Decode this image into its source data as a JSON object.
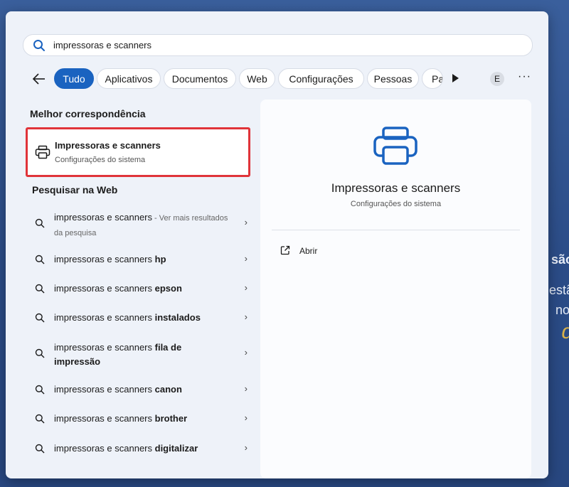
{
  "search": {
    "value": "impressoras e scanners"
  },
  "filters": {
    "tabs": [
      {
        "label": "Tudo",
        "active": true
      },
      {
        "label": "Aplicativos"
      },
      {
        "label": "Documentos"
      },
      {
        "label": "Web"
      },
      {
        "label": "Configurações"
      },
      {
        "label": "Pessoas"
      },
      {
        "label": "Pas"
      }
    ],
    "avatar_initial": "E",
    "more_label": "···"
  },
  "best_match": {
    "section_title": "Melhor correspondência",
    "title": "Impressoras e scanners",
    "subtitle": "Configurações do sistema",
    "icon": "printer-icon"
  },
  "web_search": {
    "section_title": "Pesquisar na Web",
    "items": [
      {
        "plain": "impressoras e scanners",
        "bold": "",
        "hint": " - Ver mais resultados da pesquisa"
      },
      {
        "plain": "impressoras e scanners ",
        "bold": "hp"
      },
      {
        "plain": "impressoras e scanners ",
        "bold": "epson"
      },
      {
        "plain": "impressoras e scanners ",
        "bold": "instalados"
      },
      {
        "plain": "impressoras e scanners ",
        "bold": "fila de impressão"
      },
      {
        "plain": "impressoras e scanners ",
        "bold": "canon"
      },
      {
        "plain": "impressoras e scanners ",
        "bold": "brother"
      },
      {
        "plain": "impressoras e scanners ",
        "bold": "digitalizar"
      }
    ]
  },
  "detail": {
    "title": "Impressoras e scanners",
    "subtitle": "Configurações do sistema",
    "open_label": "Abrir"
  },
  "background": {
    "line1": "são",
    "line2": "estã",
    "line3": "no,",
    "line4": "d"
  },
  "colors": {
    "accent": "#1a63c0",
    "highlight_border": "#e0343a"
  }
}
